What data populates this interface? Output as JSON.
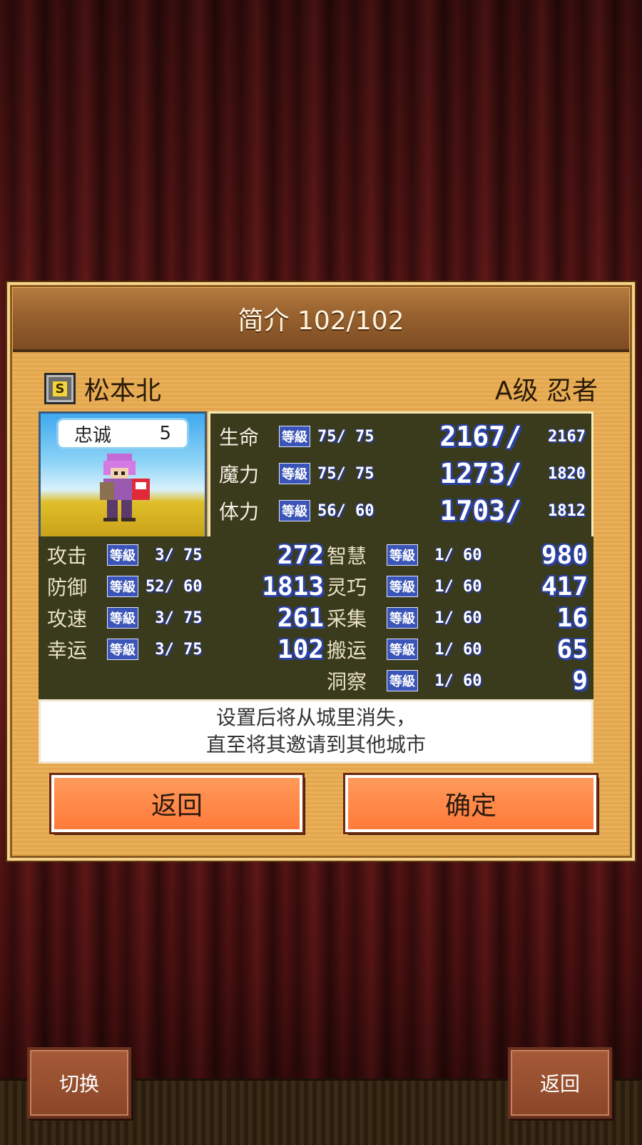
{
  "panel": {
    "title": "简介 102/102",
    "rank_icon": "S",
    "name": "松本北",
    "class": "A级 忍者"
  },
  "portrait": {
    "loyalty_label": "忠诚",
    "loyalty_value": "5"
  },
  "lv_tag": "等級",
  "vitals": [
    {
      "label": "生命",
      "level": "75/ 75",
      "current": "2167/",
      "max": "2167"
    },
    {
      "label": "魔力",
      "level": "75/ 75",
      "current": "1273/",
      "max": "1820"
    },
    {
      "label": "体力",
      "level": "56/ 60",
      "current": "1703/",
      "max": "1812"
    }
  ],
  "stats_left": [
    {
      "label": "攻击",
      "level": " 3/ 75",
      "value": "272"
    },
    {
      "label": "防御",
      "level": "52/ 60",
      "value": "1813"
    },
    {
      "label": "攻速",
      "level": " 3/ 75",
      "value": "261"
    },
    {
      "label": "幸运",
      "level": " 3/ 75",
      "value": "102"
    }
  ],
  "stats_right": [
    {
      "label": "智慧",
      "level": " 1/ 60",
      "value": "980"
    },
    {
      "label": "灵巧",
      "level": " 1/ 60",
      "value": "417"
    },
    {
      "label": "采集",
      "level": " 1/ 60",
      "value": "16"
    },
    {
      "label": "搬运",
      "level": " 1/ 60",
      "value": "65"
    },
    {
      "label": "洞察",
      "level": " 1/ 60",
      "value": "9"
    }
  ],
  "note": {
    "line1": "设置后将从城里消失，",
    "line2": "直至将其邀请到其他城市"
  },
  "buttons": {
    "back": "返回",
    "confirm": "确定"
  },
  "bottom": {
    "switch": "切换",
    "back": "返回"
  },
  "colors": {
    "panel": "#e9b05a",
    "stat_bg": "#3a3a1c",
    "button": "#ff8a4a"
  }
}
